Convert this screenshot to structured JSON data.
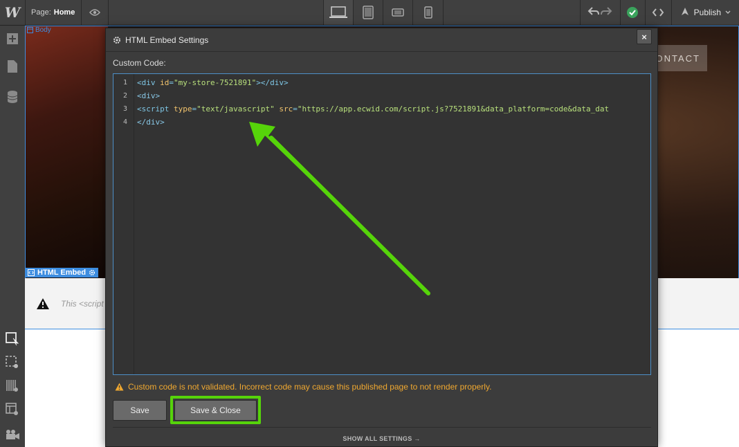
{
  "topbar": {
    "logo": "W",
    "page_label": "Page:",
    "page_name": "Home",
    "publish_label": "Publish"
  },
  "canvas": {
    "body_tag": "Body",
    "contact_label": "ONTACT",
    "embed_tag": "HTML Embed",
    "embed_message": "This <script"
  },
  "modal": {
    "title": "HTML Embed Settings",
    "close_label": "×",
    "custom_code_label": "Custom Code:",
    "line_numbers": [
      "1",
      "2",
      "3",
      "4"
    ],
    "code": {
      "l1": {
        "open": "<div ",
        "attr": "id",
        "eq": "=",
        "val": "\"my-store-7521891\"",
        "close": "></div>"
      },
      "l2": "<div>",
      "l3": {
        "open": "<script ",
        "a1": "type",
        "v1": "\"text/javascript\"",
        "a2": "src",
        "v2": "\"https://app.ecwid.com/script.js?7521891&data_platform=code&data_dat"
      },
      "l4": "</div>"
    },
    "warning": "Custom code is not validated. Incorrect code may cause this published page to not render properly.",
    "save_label": "Save",
    "save_close_label": "Save & Close",
    "show_all_label": "SHOW ALL SETTINGS →"
  },
  "colors": {
    "highlight_green": "#56d40a",
    "selection_blue": "#3d8de0",
    "warning_orange": "#f0a830"
  }
}
